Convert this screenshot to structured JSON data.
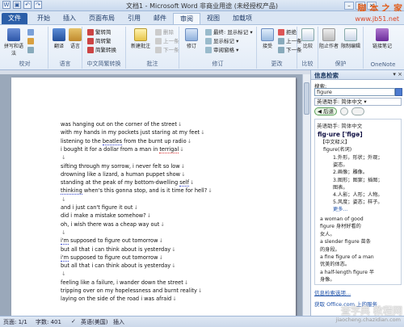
{
  "window": {
    "title": "文档1 - Microsoft Word 非商业用途 (未经授权产品)"
  },
  "watermark": {
    "top": "脚 本 之 家",
    "url": "www.jb51.net",
    "bottom_brand": "查字典 教程网",
    "bottom_url": "jiaocheng.chazidian.com"
  },
  "tabs": [
    "文件",
    "开始",
    "插入",
    "页面布局",
    "引用",
    "邮件",
    "审阅",
    "视图",
    "加载项"
  ],
  "active_tab": "审阅",
  "ribbon": {
    "proofing": {
      "label": "校对",
      "spell": "拼写和语法",
      "dictionary": "信息检索",
      "thesaurus": "同义词库",
      "wordcount": "字数统计"
    },
    "language": {
      "label": "语言",
      "translate": "翻译",
      "language": "语言"
    },
    "chinese": {
      "label": "中文简繁转换",
      "to_trad": "繁转简",
      "to_simp": "简转繁",
      "convert": "简繁转换"
    },
    "comments": {
      "label": "批注",
      "new": "新建批注",
      "delete": "删除",
      "prev": "上一条",
      "next": "下一条"
    },
    "tracking": {
      "label": "修订",
      "track": "修订",
      "markup": "最终: 显示标记",
      "show": "显示标记",
      "pane": "审阅窗格"
    },
    "changes": {
      "label": "更改",
      "accept": "接受",
      "reject": "拒绝",
      "prev": "上一条",
      "next": "下一条"
    },
    "compare": {
      "label": "比较",
      "compare": "比较"
    },
    "protect": {
      "label": "保护",
      "block": "阻止作者",
      "restrict": "限制编辑"
    },
    "onenote": {
      "label": "OneNote",
      "linked": "链接笔记"
    }
  },
  "document": {
    "lines": [
      "was hanging out on the corner of the street",
      "with my hands in my pockets just staring at my feet",
      "listening to the beatles from the burnt up radio",
      "i bought it for a dollar from a man in terrigal",
      "",
      "sifting through my sorrow, i never felt so low",
      "drowning like a lizard, a human puppet show",
      "standing at the peak of my bottom-dwelling  self",
      "thinking when's this gonna stop, and is it time for hell?",
      "",
      "and i just can't figure it out",
      "did i make a mistake somehow?",
      "oh, i wish there was a cheap way out",
      "",
      "i'm supposed to figure out tomorrow",
      "but all that i can think about is yesterday",
      "i'm supposed to figure out tomorrow",
      "but all that i can think about is yesterday",
      "",
      "feeling like a failure, i wander down the street",
      "tripping over on my hopelessness and burnt reality",
      "laying on the side of the road i was afraid"
    ]
  },
  "pane": {
    "title": "信息检索",
    "search_label": "搜索:",
    "search_value": "figure",
    "source": "英语助手: 简体中文",
    "back": "后退",
    "result_source": "英语助手: 简体中文",
    "word": "fig·ure ['figə]",
    "section": "【中文释义】",
    "pos": "figure(名词)",
    "senses": [
      "1.外形，形状；外观；",
      "姿态。",
      "2.画像；雕像。",
      "3.图形；图案；插图；",
      "图表。",
      "4.人影；人形；人物。",
      "5.风度；姿态；样子。",
      "更多..."
    ],
    "examples": [
      "a woman of good",
      "figure 身材好看的",
      "女人。",
      "a slender figure 苗条",
      "的身段。",
      "a fine figure of a man",
      "优美的体态。",
      "a half-length figure 半",
      "身像。"
    ],
    "bottom_link": "获取 Office.com 上的服务",
    "options": "信息检索选项..."
  },
  "status": {
    "page": "页面: 1/1",
    "words": "字数: 401",
    "lang": "英语(美国)",
    "insert": "插入"
  }
}
